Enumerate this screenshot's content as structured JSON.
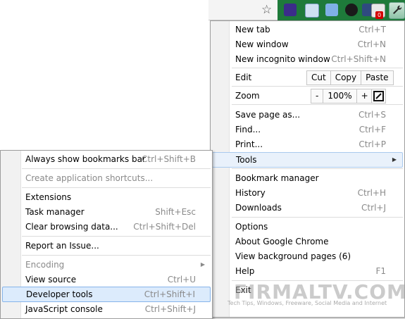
{
  "toolbar": {
    "badge_count": "0",
    "icons": [
      "star-icon",
      "extension-icon-1",
      "extension-icon-2",
      "extension-icon-3",
      "extension-icon-4",
      "extension-icon-5",
      "extension-icon-6",
      "wrench-icon"
    ]
  },
  "main_menu": {
    "new_tab": {
      "label": "New tab",
      "shortcut": "Ctrl+T"
    },
    "new_window": {
      "label": "New window",
      "shortcut": "Ctrl+N"
    },
    "new_incognito": {
      "label": "New incognito window",
      "shortcut": "Ctrl+Shift+N"
    },
    "edit": {
      "label": "Edit",
      "cut": "Cut",
      "copy": "Copy",
      "paste": "Paste"
    },
    "zoom": {
      "label": "Zoom",
      "minus": "-",
      "level": "100%",
      "plus": "+"
    },
    "save_page": {
      "label": "Save page as...",
      "shortcut": "Ctrl+S"
    },
    "find": {
      "label": "Find...",
      "shortcut": "Ctrl+F"
    },
    "print": {
      "label": "Print...",
      "shortcut": "Ctrl+P"
    },
    "tools": {
      "label": "Tools"
    },
    "bookmark_manager": {
      "label": "Bookmark manager"
    },
    "history": {
      "label": "History",
      "shortcut": "Ctrl+H"
    },
    "downloads": {
      "label": "Downloads",
      "shortcut": "Ctrl+J"
    },
    "options": {
      "label": "Options"
    },
    "about": {
      "label": "About Google Chrome"
    },
    "background_pages": {
      "label": "View background pages (6)"
    },
    "help": {
      "label": "Help",
      "shortcut": "F1"
    },
    "exit": {
      "label": "Exit"
    }
  },
  "tools_menu": {
    "bookmarks_bar": {
      "label": "Always show bookmarks bar",
      "shortcut": "Ctrl+Shift+B"
    },
    "app_shortcuts": {
      "label": "Create application shortcuts..."
    },
    "extensions": {
      "label": "Extensions"
    },
    "task_manager": {
      "label": "Task manager",
      "shortcut": "Shift+Esc"
    },
    "clear_data": {
      "label": "Clear browsing data...",
      "shortcut": "Ctrl+Shift+Del"
    },
    "report_issue": {
      "label": "Report an Issue..."
    },
    "encoding": {
      "label": "Encoding"
    },
    "view_source": {
      "label": "View source",
      "shortcut": "Ctrl+U"
    },
    "developer_tools": {
      "label": "Developer tools",
      "shortcut": "Ctrl+Shift+I"
    },
    "js_console": {
      "label": "JavaScript console",
      "shortcut": "Ctrl+Shift+J"
    }
  },
  "watermark": {
    "title": "FIRMALTV.COM",
    "subtitle": "Tech Tips, Windows, Freeware, Social Media and Internet"
  },
  "colors": {
    "toolbar": "#1e7a3a",
    "highlight": "#dcebfc",
    "highlight_border": "#86b4ea",
    "disabled_text": "#8a8a8a"
  }
}
